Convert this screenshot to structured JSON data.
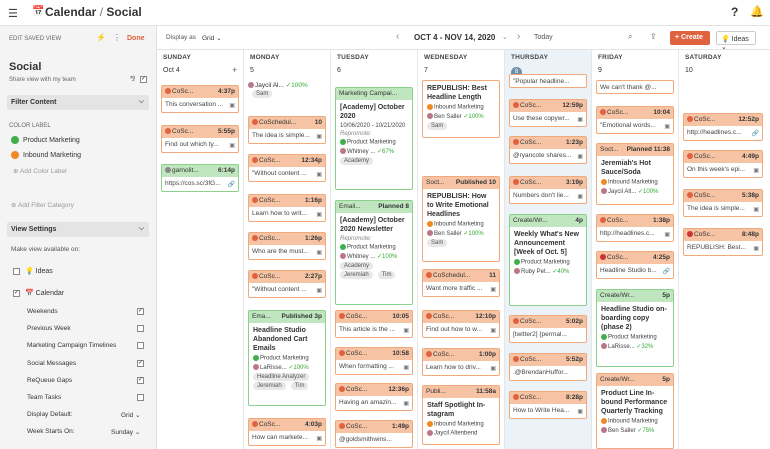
{
  "app": {
    "title": "Calendar",
    "section": "Social",
    "separator": "/"
  },
  "topbar": {
    "help": "?",
    "bell": "🔔",
    "menu": "☰",
    "calendar_icon": "📅"
  },
  "sidebar": {
    "edit_saved_view": "EDIT SAVED VIEW",
    "done": "Done",
    "view_name": "Social",
    "share_label": "Share view with my team",
    "filter_content": "Filter Content",
    "color_label": "COLOR LABEL",
    "labels": [
      {
        "name": "Product Marketing",
        "color": "#3eaf4a"
      },
      {
        "name": "Inbound Marketing",
        "color": "#f08a24"
      }
    ],
    "add_color_label": "Add Color Label",
    "add_filter_category": "Add Filter Category",
    "view_settings": "View Settings",
    "make_available": "Make view available on:",
    "ideas": "Ideas",
    "calendar": "Calendar",
    "options": [
      {
        "label": "Weekends",
        "checked": true
      },
      {
        "label": "Previous Week",
        "checked": false
      },
      {
        "label": "Marketing Campaign Timelines",
        "checked": false
      },
      {
        "label": "Social Messages",
        "checked": true
      },
      {
        "label": "ReQueue Gaps",
        "checked": true
      },
      {
        "label": "Team Tasks",
        "checked": false
      }
    ],
    "display_default_label": "Display Default:",
    "display_default_value": "Grid",
    "week_starts_label": "Week Starts On:",
    "week_starts_value": "Sunday"
  },
  "toolbar": {
    "display_as": "Display as",
    "grid": "Grid",
    "range": "OCT 4 - NOV 14, 2020",
    "today": "Today",
    "create": "Create",
    "ideas": "Ideas"
  },
  "columns": [
    {
      "name": "SUNDAY",
      "date": "Oct 4"
    },
    {
      "name": "MONDAY",
      "date": "5"
    },
    {
      "name": "TUESDAY",
      "date": "6"
    },
    {
      "name": "WEDNESDAY",
      "date": "7"
    },
    {
      "name": "THURSDAY",
      "date": "8"
    },
    {
      "name": "FRIDAY",
      "date": "9"
    },
    {
      "name": "SATURDAY",
      "date": "10"
    }
  ],
  "sunday": [
    {
      "label": "CoSc...",
      "time": "4:37p",
      "text": "This conversation ..."
    },
    {
      "label": "CoSc...",
      "time": "5:55p",
      "text": "Find out which ty..."
    },
    {
      "label": "garnolit...",
      "time": "6:14p",
      "text": "https://cos.sc/3fG..."
    }
  ],
  "monday": {
    "first": {
      "person": "Jaycil Al...",
      "pct": "✓100%",
      "tag": "Sam"
    },
    "cards": [
      {
        "label": "CoSchedul...",
        "time": "10",
        "text": "The idea is simple..."
      },
      {
        "label": "CoSc...",
        "time": "12:34p",
        "text": "\"Without content ..."
      },
      {
        "label": "CoSc...",
        "time": "1:16p",
        "text": "Learn how to writ..."
      },
      {
        "label": "CoSc...",
        "time": "1:26p",
        "text": "Who are the must..."
      },
      {
        "label": "CoSc...",
        "time": "2:27p",
        "text": "\"Without content ..."
      }
    ],
    "email": {
      "label": "Ema...",
      "status": "Published 3p",
      "title": "Headline Studio Abandoned Cart Emails",
      "tag": "Product Marketing",
      "person": "LaRisse...",
      "pct": "✓100%",
      "pill1": "Headline Analyzer",
      "pill2": "Jeremiah",
      "pill3": "Tim"
    },
    "last": {
      "label": "CoSc...",
      "time": "4:03p",
      "text": "How can markete..."
    }
  },
  "tuesday": {
    "campaign": {
      "label": "Marketing Campai...",
      "title": "[Academy] October 2020",
      "dates": "10/06/2020 - 10/21/2020",
      "repromote": "Repromote:",
      "tag": "Product Marketing",
      "person": "Whitney ...",
      "pct": "✓67%",
      "pill": "Academy"
    },
    "email": {
      "label": "Email...",
      "status": "Planned 8",
      "title": "[Academy] October 2020 Newsletter",
      "repromote": "Repromote:",
      "tag": "Product Marketing",
      "person": "Whitney ...",
      "pct": "✓100%",
      "pill1": "Academy",
      "pill2": "Jeremiah",
      "pill3": "Tim"
    },
    "cards": [
      {
        "label": "CoSc...",
        "time": "10:05",
        "text": "This article is the ..."
      },
      {
        "label": "CoSc...",
        "time": "10:58",
        "text": "When formatting ..."
      },
      {
        "label": "CoSc...",
        "time": "12:36p",
        "text": "Having an amazin..."
      },
      {
        "label": "CoSc...",
        "time": "1:49p",
        "text": "@goldsmithwins..."
      }
    ]
  },
  "wednesday": {
    "rep1": {
      "title": "REPUBLISH: Best Headline Length",
      "tag": "Inbound Marketing",
      "person": "Ben Saller",
      "pct": "✓100%",
      "pill": "Sam"
    },
    "rep2": {
      "label": "Soct...",
      "status": "Published 10",
      "title": "REPUBLISH: How to Write Emotional Headlines",
      "tag": "Inbound Marketing",
      "person": "Ben Saller",
      "pct": "✓100%",
      "pill": "Sam"
    },
    "cards": [
      {
        "label": "CoSchedul...",
        "time": "11",
        "text": "Want more traffic ..."
      },
      {
        "label": "CoSc...",
        "time": "12:10p",
        "text": "Find out how to w..."
      },
      {
        "label": "CoSc...",
        "time": "1:00p",
        "text": "Learn how to driv..."
      }
    ],
    "pub": {
      "label": "Publi...",
      "status": "11:58a",
      "title": "Staff Spotlight In-stagram",
      "tag": "Inbound Marketing",
      "person": "Jaycil Altenbend"
    }
  },
  "thursday": {
    "first": {
      "text": "\"Popular headline..."
    },
    "cards": [
      {
        "label": "CoSc...",
        "time": "12:59p",
        "text": "Use these copywr..."
      },
      {
        "label": "CoSc...",
        "time": "1:23p",
        "text": "@ryancote shares..."
      },
      {
        "label": "CoSc...",
        "time": "3:19p",
        "text": "Numbers don't lie..."
      }
    ],
    "task": {
      "label": "Create/Wr...",
      "time": "4p",
      "title": "Weekly What's New Announcement [Week of Oct. 5]",
      "tag": "Product Marketing",
      "person": "Ruby Pet...",
      "pct": "✓40%"
    },
    "cards2": [
      {
        "label": "CoSc...",
        "time": "5:02p",
        "text": "[twitter2] {permal..."
      },
      {
        "label": "CoSc...",
        "time": "5:52p",
        "text": ".@BrendanHuffor..."
      },
      {
        "label": "CoSc...",
        "time": "8:28p",
        "text": "How to Write Hea..."
      }
    ]
  },
  "friday": {
    "first": {
      "text": "We can't thank @..."
    },
    "cards": [
      {
        "label": "CoSc...",
        "time": "10:04",
        "text": "\"Emotional words..."
      }
    ],
    "planned": {
      "label": "Soct...",
      "status": "Planned 11:38",
      "title": "Jeremiah's Hot Sauce/Soda",
      "tag": "Inbound Marketing",
      "person": "Jaycil Alt...",
      "pct": "✓100%"
    },
    "cards2": [
      {
        "label": "CoSc...",
        "time": "1:38p",
        "text": "http://headlines.c..."
      },
      {
        "label": "CoSc...",
        "time": "4:25p",
        "text": "Headline Studio b..."
      }
    ],
    "task1": {
      "label": "Create/Wr...",
      "time": "5p",
      "title": "Headline Studio on-boarding copy (phase 2)",
      "tag": "Product Marketing",
      "person": "LaRisse...",
      "pct": "✓32%"
    },
    "task2": {
      "label": "Create/Wr...",
      "time": "5p",
      "title": "Product Line In-bound Performance Quarterly Tracking",
      "tag": "Inbound Marketing",
      "person": "Ben Saller",
      "pct": "✓75%"
    }
  },
  "saturday": [
    {
      "label": "CoSc...",
      "time": "12:52p",
      "text": "http://headlines.c..."
    },
    {
      "label": "CoSc...",
      "time": "4:49p",
      "text": "On this week's epi..."
    },
    {
      "label": "CoSc...",
      "time": "5:38p",
      "text": "The idea is simple..."
    },
    {
      "label": "CoSc...",
      "time": "8:48p",
      "text": "REPUBLISH: Best..."
    }
  ]
}
